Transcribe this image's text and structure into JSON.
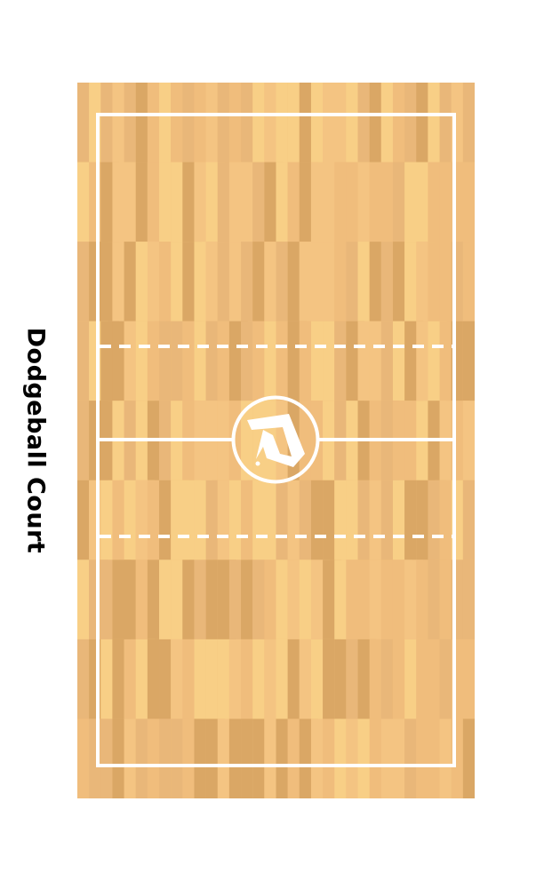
{
  "title": "Dodgeball Court",
  "colors": {
    "wood_palette": [
      "#f0bd7c",
      "#f8cf86",
      "#e9b779",
      "#daa765",
      "#f4c482"
    ],
    "line_color": "#ffffff",
    "background": "#ffffff",
    "title_color": "#000000"
  },
  "icons": {
    "center_logo": "stylized-letter-logo-icon"
  }
}
